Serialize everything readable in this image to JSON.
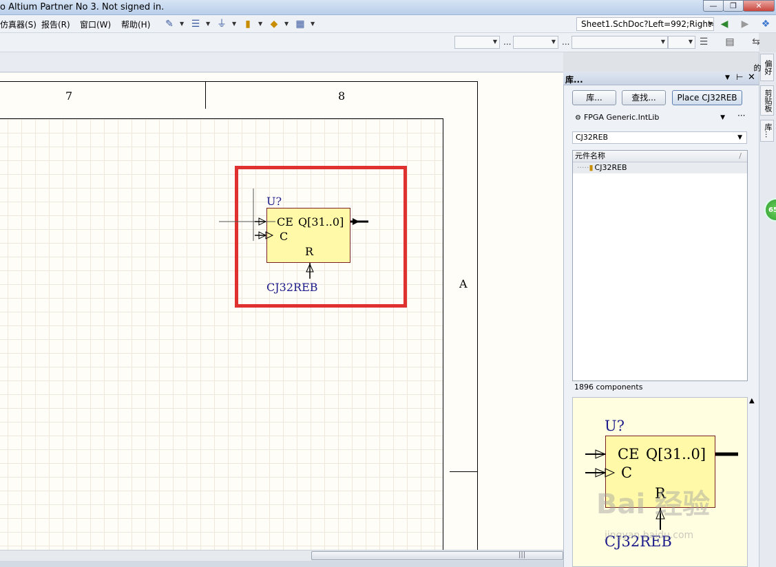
{
  "window": {
    "title": "o Altium Partner No 3. Not signed in."
  },
  "menu": {
    "items": [
      "仿真器(S)",
      "报告(R)",
      "窗口(W)",
      "帮助(H)"
    ]
  },
  "address": {
    "value": "Sheet1.SchDoc?Left=992;Right="
  },
  "sheet": {
    "zone_7": "7",
    "zone_8": "8",
    "zone_a": "A"
  },
  "component": {
    "designator": "U?",
    "pin_ce": "CE",
    "pin_q": "Q[31..0]",
    "pin_c": "C",
    "pin_r": "R",
    "name": "CJ32REB"
  },
  "panel": {
    "title": "库...",
    "libraries_button": "库...",
    "search_button": "查找...",
    "place_button": "Place CJ32REB",
    "library_selected": "FPGA Generic.IntLib",
    "filter_value": "CJ32REB",
    "column_header": "元件名称",
    "rows": [
      {
        "name": "CJ32REB"
      }
    ],
    "component_count": "1896 components"
  },
  "side_tabs": [
    "偏好的",
    "剪贴板",
    "库..."
  ],
  "badge": "65",
  "watermark": {
    "main": "Bai 经验",
    "sub": "jingyan.baidu.com"
  },
  "colors": {
    "highlight": "#e03131",
    "component_fill": "#fff9a8",
    "designator_text": "#1a1a8a"
  }
}
